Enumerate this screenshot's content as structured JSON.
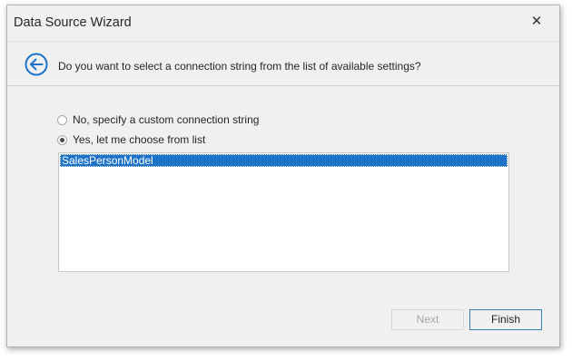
{
  "window": {
    "title": "Data Source Wizard",
    "close_glyph": "✕"
  },
  "header": {
    "back_icon": "back-arrow-circle-icon",
    "question": "Do you want to select a connection string from the list of available settings?"
  },
  "options": [
    {
      "label": "No, specify a custom connection string",
      "selected": false
    },
    {
      "label": "Yes, let me choose from list",
      "selected": true
    }
  ],
  "connection_list": {
    "items": [
      "SalesPersonModel"
    ],
    "selected_index": 0
  },
  "footer": {
    "next_label": "Next",
    "next_enabled": false,
    "finish_label": "Finish"
  },
  "colors": {
    "accent": "#1e73c9",
    "back_icon": "#1e73c9",
    "focus_border": "#3c7fb1"
  }
}
